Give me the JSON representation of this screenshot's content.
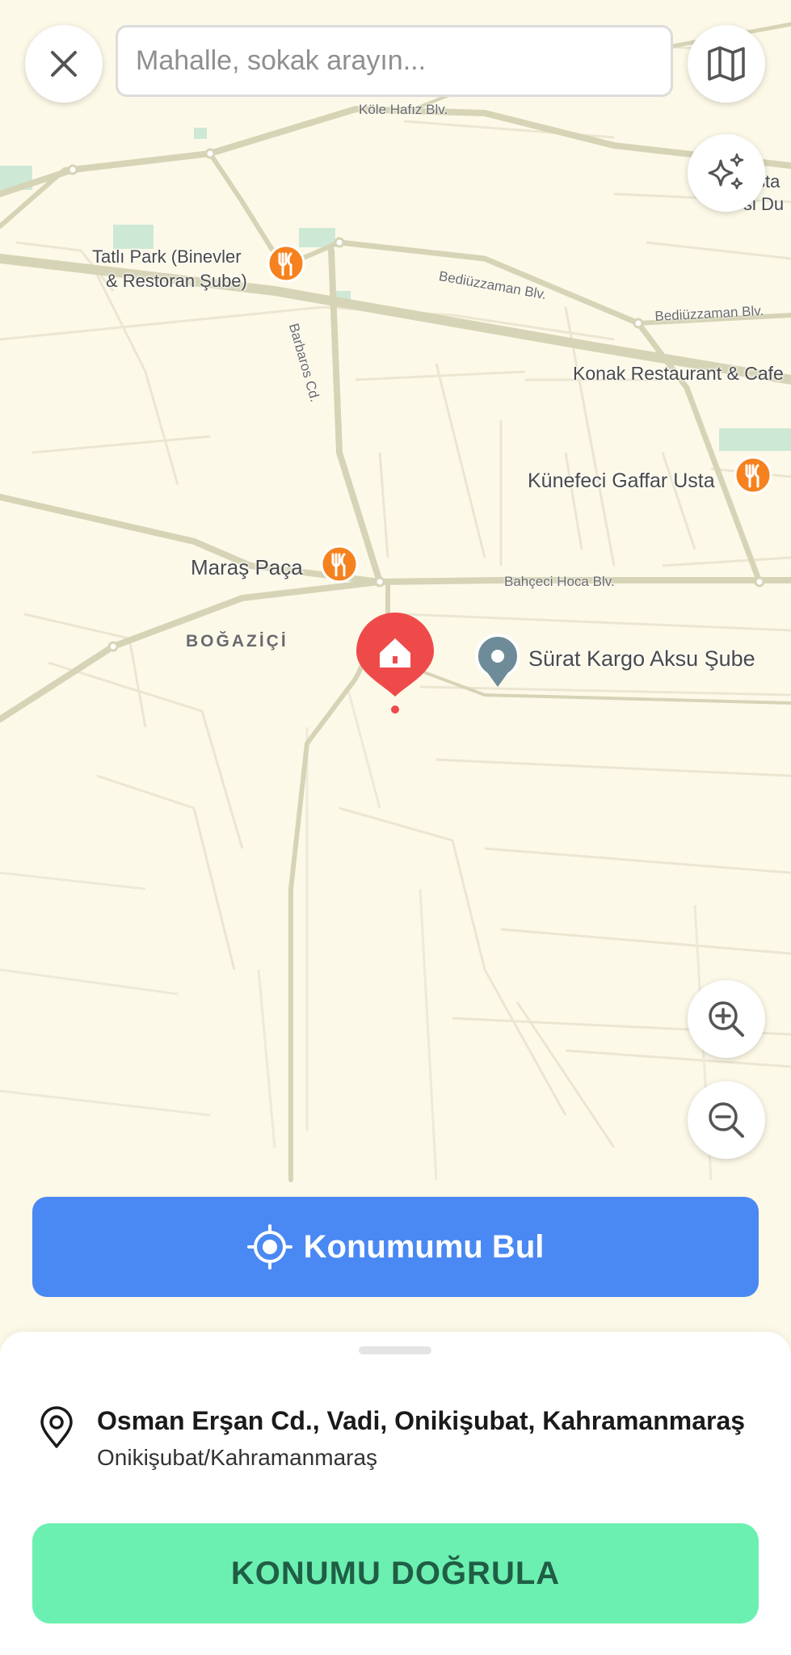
{
  "search": {
    "placeholder": "Mahalle, sokak arayın..."
  },
  "icons": {
    "close": "close-icon",
    "map": "map-icon",
    "sparkle": "sparkle-icon",
    "zoom_in": "zoom-in-icon",
    "zoom_out": "zoom-out-icon",
    "locate": "crosshair-icon",
    "location_pin": "location-pin-icon",
    "home_marker": "home-marker-icon",
    "restaurant": "fork-knife-icon"
  },
  "map": {
    "streets": {
      "kole_hafiz": "Köle Hafız Blv.",
      "bediuzzaman_1": "Bediüzzaman Blv.",
      "bediuzzaman_2": "Bediüzzaman Blv.",
      "barbaros": "Barbaros Cd.",
      "bahceci_hoca": "Bahçeci Hoca Blv."
    },
    "places": {
      "tatli_park_1": "Tatlı Park (Binevler",
      "tatli_park_2": "& Restoran Şube)",
      "konak": "Konak Restaurant & Cafe",
      "kunefeci": "Künefeci Gaffar Usta",
      "maras_paca": "Maraş Paça",
      "surat_kargo": "Sürat Kargo Aksu Şube",
      "top_right_1": "sta",
      "top_right_2": "si Du"
    },
    "district": "BOĞAZİÇİ"
  },
  "actions": {
    "find_location": "Konumumu Bul",
    "confirm_location": "KONUMU DOĞRULA"
  },
  "address": {
    "title": "Osman Erşan Cd., Vadi, Onikişubat, Kahramanmaraş",
    "subtitle": "Onikişubat/Kahramanmaraş"
  },
  "colors": {
    "primary_blue": "#4a89f3",
    "confirm_green": "#6cf0b1",
    "marker_red": "#ef4a4a",
    "poi_orange": "#f5821f",
    "map_background": "#fdf9e8",
    "major_road": "#d6d4b6"
  }
}
